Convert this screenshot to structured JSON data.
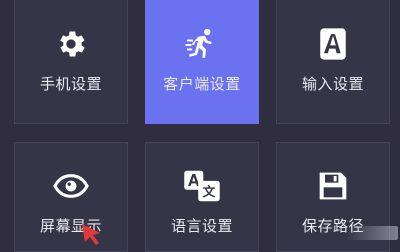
{
  "settings_menu": {
    "tiles": [
      {
        "label": "手机设置",
        "icon": "gear-icon",
        "active": false
      },
      {
        "label": "客户端设置",
        "icon": "running-person-icon",
        "active": true
      },
      {
        "label": "输入设置",
        "icon": "keyboard-a-icon",
        "active": false
      },
      {
        "label": "屏幕显示",
        "icon": "eye-icon",
        "active": false
      },
      {
        "label": "语言设置",
        "icon": "translate-icon",
        "active": false
      },
      {
        "label": "保存路径",
        "icon": "save-floppy-icon",
        "active": false
      }
    ]
  },
  "colors": {
    "background": "#2f2d3f",
    "tile": "#363447",
    "tile_active": "#6a72f0",
    "text": "#e9e9f2",
    "cursor": "#e0393b"
  }
}
